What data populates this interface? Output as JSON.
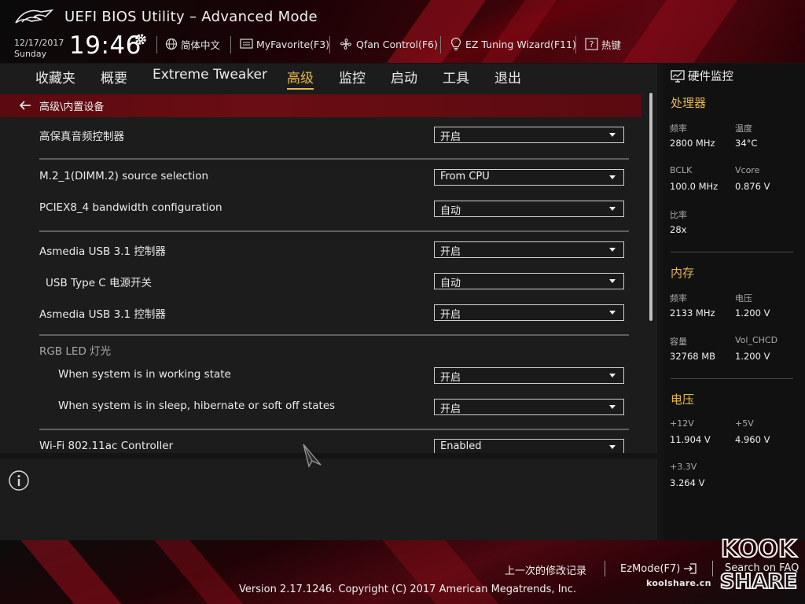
{
  "header": {
    "title": "UEFI BIOS Utility – Advanced Mode",
    "date": "12/17/2017",
    "weekday": "Sunday",
    "time": "19:46",
    "toolbar": {
      "language": "简体中文",
      "myfavorite": "MyFavorite(F3)",
      "qfan": "Qfan Control(F6)",
      "ez_tuning": "EZ Tuning Wizard(F11)",
      "hotkeys": "热键"
    }
  },
  "menu": {
    "items": [
      "收藏夹",
      "概要",
      "Extreme Tweaker",
      "高级",
      "监控",
      "启动",
      "工具",
      "退出"
    ],
    "active": "高级"
  },
  "main": {
    "breadcrumb": "高级\\内置设备",
    "settings": [
      {
        "label": "高保真音频控制器",
        "value": "开启"
      },
      {
        "label": "M.2_1(DIMM.2) source selection",
        "value": "From CPU"
      },
      {
        "label": "PCIEX8_4 bandwidth configuration",
        "value": "自动"
      },
      {
        "label": "Asmedia USB 3.1 控制器",
        "value": "开启"
      },
      {
        "label": "USB Type C 电源开关",
        "value": "自动"
      },
      {
        "label": "Asmedia USB 3.1 控制器",
        "value": "开启"
      },
      {
        "label": "When system is in working state",
        "value": "开启"
      },
      {
        "label": "When system is in sleep, hibernate or soft off states",
        "value": "开启"
      },
      {
        "label": "Wi-Fi 802.11ac Controller",
        "value": "Enabled"
      }
    ],
    "section_rgb": "RGB LED 灯光"
  },
  "hardware_monitor": {
    "title": "硬件监控",
    "cpu": {
      "section": "处理器",
      "freq_label": "频率",
      "freq": "2800 MHz",
      "temp_label": "温度",
      "temp": "34°C",
      "bclk_label": "BCLK",
      "bclk": "100.0 MHz",
      "vcore_label": "Vcore",
      "vcore": "0.876 V",
      "ratio_label": "比率",
      "ratio": "28x"
    },
    "memory": {
      "section": "内存",
      "freq_label": "频率",
      "freq": "2133 MHz",
      "volt_label": "电压",
      "volt": "1.200 V",
      "cap_label": "容量",
      "cap": "32768 MB",
      "chcd_label": "Vol_CHCD",
      "chcd": "1.200 V"
    },
    "voltage": {
      "section": "电压",
      "v12_label": "+12V",
      "v12": "11.904 V",
      "v5_label": "+5V",
      "v5": "4.960 V",
      "v33_label": "+3.3V",
      "v33": "3.264 V"
    }
  },
  "footer": {
    "last_changes": "上一次的修改记录",
    "ezmode": "EzMode(F7)",
    "search": "Search on FAQ",
    "version": "Version 2.17.1246. Copyright (C) 2017 American Megatrends, Inc."
  },
  "watermark": {
    "top": "KOOK",
    "bottom": "SHARE",
    "url": "koolshare.cn"
  },
  "colors": {
    "accent": "#e6b84a",
    "brand_red": "#6b0d14"
  }
}
